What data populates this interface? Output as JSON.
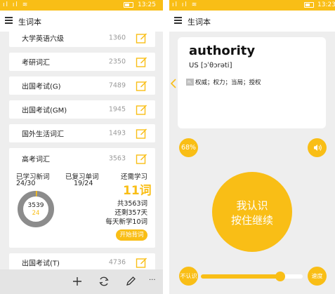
{
  "colors": {
    "accent": "#f9be16",
    "background": "#eeeeee",
    "card": "#ffffff"
  },
  "left": {
    "status": {
      "icons": "ıl ıl ≋",
      "time": "13:25"
    },
    "title": "生词本",
    "rows": [
      {
        "name": "大学英语六级",
        "count": "1360"
      },
      {
        "name": "考研词汇",
        "count": "2350"
      },
      {
        "name": "出国考试(G)",
        "count": "7489"
      },
      {
        "name": "出国考试(GM)",
        "count": "1945"
      },
      {
        "name": "国外生活词汇",
        "count": "1493"
      }
    ],
    "expanded": {
      "name": "高考词汇",
      "count": "3563",
      "learned_label": "已学习新词",
      "learned_value": "24/30",
      "reviewed_label": "已复习单词",
      "reviewed_value": "19/24",
      "need_label": "还需学习",
      "need_value": "11词",
      "donut_total": "3539",
      "donut_sub": "24",
      "donut_progress": 0.0068,
      "total_text": "共3563词",
      "remaining_text": "还剩357天",
      "daily_text": "每天新学10词",
      "start_label": "开始背词"
    },
    "last_row": {
      "name": "出国考试(T)",
      "count": "4736"
    },
    "toolbar_icons": [
      "add-icon",
      "refresh-icon",
      "pencil-icon",
      "more-icon"
    ],
    "more_label": "···"
  },
  "right": {
    "status": {
      "icons": "ıl ıl ≋",
      "time": "13:23"
    },
    "title": "生词本",
    "word": "authority",
    "phonetic": "US [ɔˈθɔrəti]",
    "pos": "n.",
    "meaning": "权威；权力；当局；授权",
    "percent": "68%",
    "know_line1": "我认识",
    "know_line2": "按住继续",
    "unknown_label": "不认识",
    "speed_label": "速度",
    "speed_level": 0.78
  }
}
